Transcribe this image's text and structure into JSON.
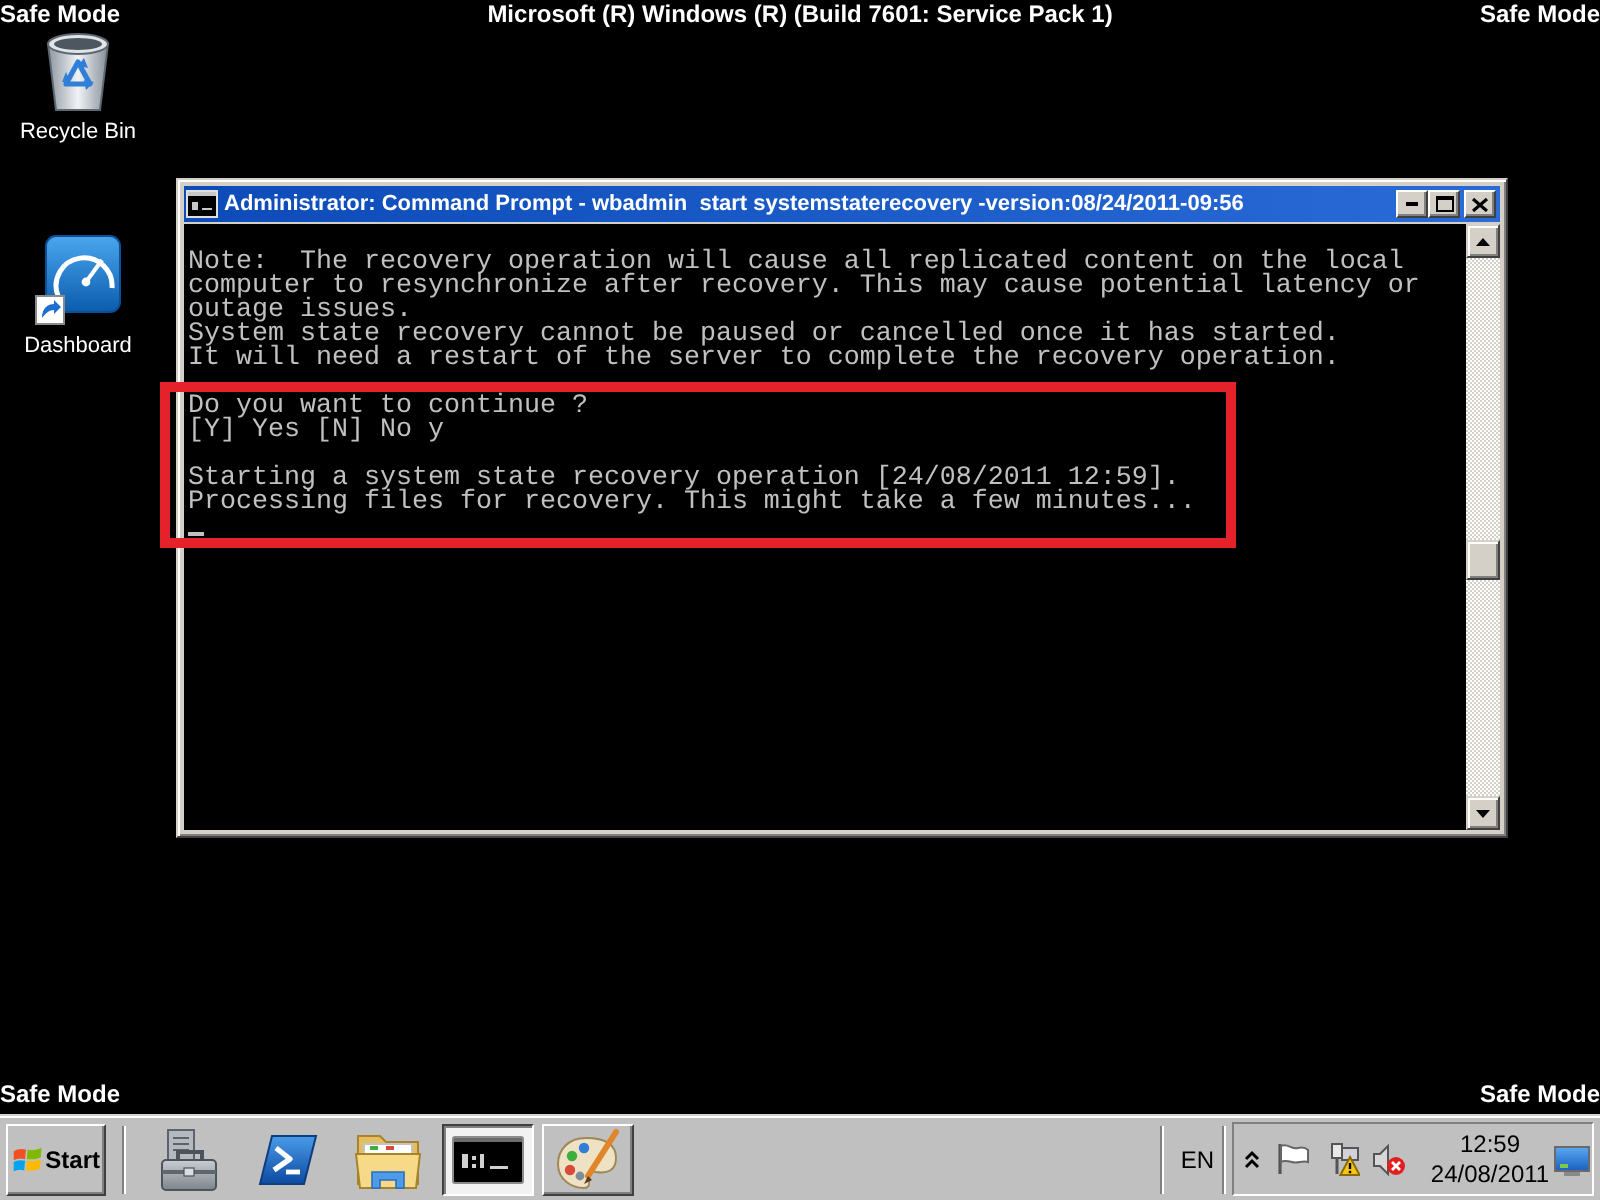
{
  "desktop": {
    "top_left_label": "Safe Mode",
    "top_title": "Microsoft (R) Windows (R) (Build 7601: Service Pack 1)",
    "top_right_label": "Safe Mode",
    "icons": [
      {
        "kind": "recycle-bin",
        "label": "Recycle Bin"
      },
      {
        "kind": "dashboard",
        "label": "Dashboard"
      }
    ],
    "bottom_left_label": "Safe Mode",
    "bottom_right_label": "Safe Mode"
  },
  "window": {
    "title": "Administrator: Command Prompt - wbadmin  start systemstaterecovery -version:08/24/2011-09:56",
    "console": {
      "blocks": [
        {
          "lines": [
            "Note:  The recovery operation will cause all replicated content on the local",
            "computer to resynchronize after recovery. This may cause potential latency or",
            "outage issues.",
            "System state recovery cannot be paused or cancelled once it has started.",
            "It will need a restart of the server to complete the recovery operation."
          ]
        }
      ],
      "highlighted_blocks": [
        {
          "lines": [
            "Do you want to continue ?",
            "[Y] Yes [N] No y"
          ]
        },
        {
          "lines": [
            "Starting a system state recovery operation [24/08/2011 12:59].",
            "Processing files for recovery. This might take a few minutes..."
          ]
        }
      ]
    }
  },
  "taskbar": {
    "start": "Start",
    "buttons": [
      {
        "kind": "server-manager",
        "open": false,
        "selected": false
      },
      {
        "kind": "shell",
        "open": false,
        "selected": false
      },
      {
        "kind": "explorer",
        "open": false,
        "selected": false
      },
      {
        "kind": "command-prompt",
        "open": true,
        "selected": true
      },
      {
        "kind": "paint",
        "open": true,
        "selected": false
      }
    ],
    "language": "EN",
    "tray_icons": [
      {
        "kind": "action-center"
      },
      {
        "kind": "network-warning"
      },
      {
        "kind": "volume-muted"
      }
    ],
    "clock": {
      "time": "12:59",
      "date": "24/08/2011"
    }
  }
}
